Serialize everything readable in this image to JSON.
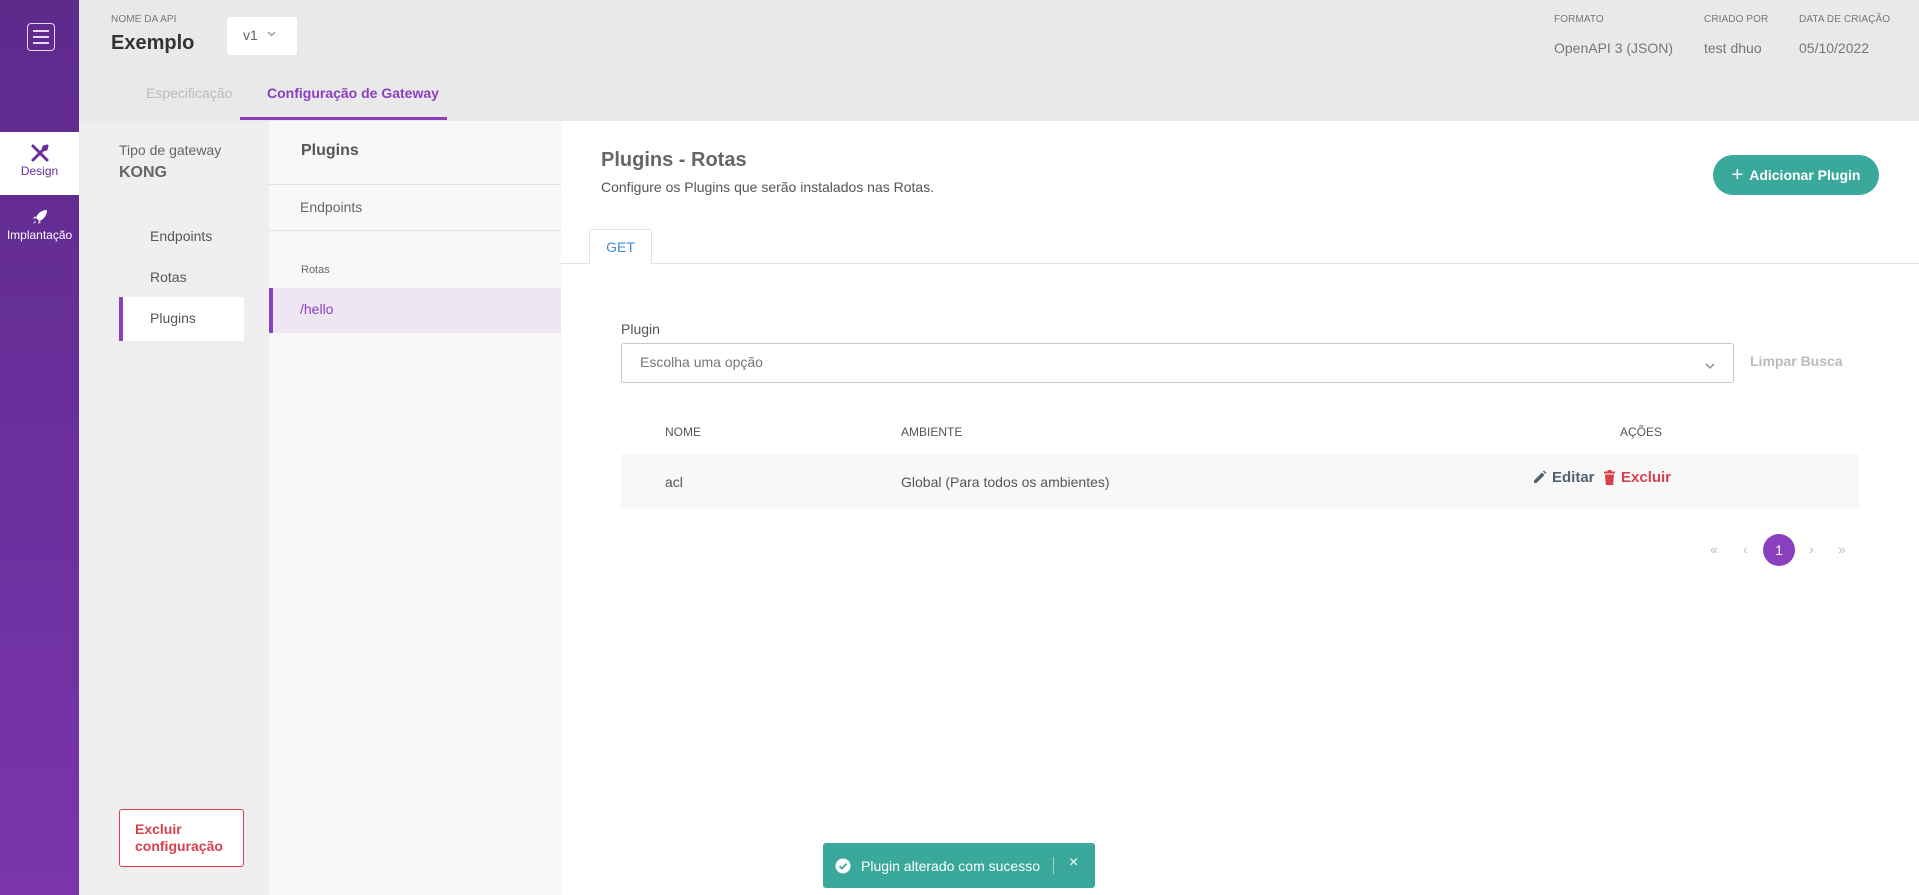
{
  "rail": {
    "items": [
      {
        "label": "Design",
        "icon": "design-tools-icon",
        "active": true
      },
      {
        "label": "Implantação",
        "icon": "rocket-icon",
        "active": false
      }
    ]
  },
  "header": {
    "api_name_label": "NOME DA API",
    "api_name": "Exemplo",
    "version": "v1",
    "format_label": "FORMATO",
    "format_value": "OpenAPI 3 (JSON)",
    "created_by_label": "CRIADO POR",
    "created_by_value": "test dhuo",
    "created_date_label": "DATA DE CRIAÇÃO",
    "created_date_value": "05/10/2022",
    "tabs": [
      {
        "label": "Especificação",
        "active": false
      },
      {
        "label": "Configuração de Gateway",
        "active": true
      }
    ]
  },
  "gateway": {
    "type_label": "Tipo de gateway",
    "type_value": "KONG",
    "nav": [
      {
        "label": "Endpoints",
        "active": false
      },
      {
        "label": "Rotas",
        "active": false
      },
      {
        "label": "Plugins",
        "active": true
      }
    ],
    "delete_label_line1": "Excluir",
    "delete_label_line2": "configuração"
  },
  "plugins_panel": {
    "title": "Plugins",
    "endpoints_label": "Endpoints",
    "routes_label": "Rotas",
    "routes": [
      "/hello"
    ]
  },
  "main": {
    "title": "Plugins - Rotas",
    "subtitle": "Configure os Plugins que serão instalados nas Rotas.",
    "add_button": "Adicionar Plugin",
    "method_tab": "GET",
    "filter_label": "Plugin",
    "filter_placeholder": "Escolha uma opção",
    "clear_button": "Limpar Busca",
    "table": {
      "columns": [
        "NOME",
        "AMBIENTE",
        "AÇÕES"
      ],
      "rows": [
        {
          "name": "acl",
          "environment": "Global (Para todos os ambientes)"
        }
      ],
      "edit_label": "Editar",
      "delete_label": "Excluir"
    },
    "pagination": {
      "first": "«",
      "prev": "‹",
      "current": "1",
      "next": "›",
      "last": "»"
    }
  },
  "toast": {
    "message": "Plugin alterado com sucesso",
    "close": "×"
  },
  "colors": {
    "brand_purple": "#8a3fbf",
    "rail_purple": "#6a2f9c",
    "teal": "#3aa99b",
    "danger": "#d9404e"
  }
}
